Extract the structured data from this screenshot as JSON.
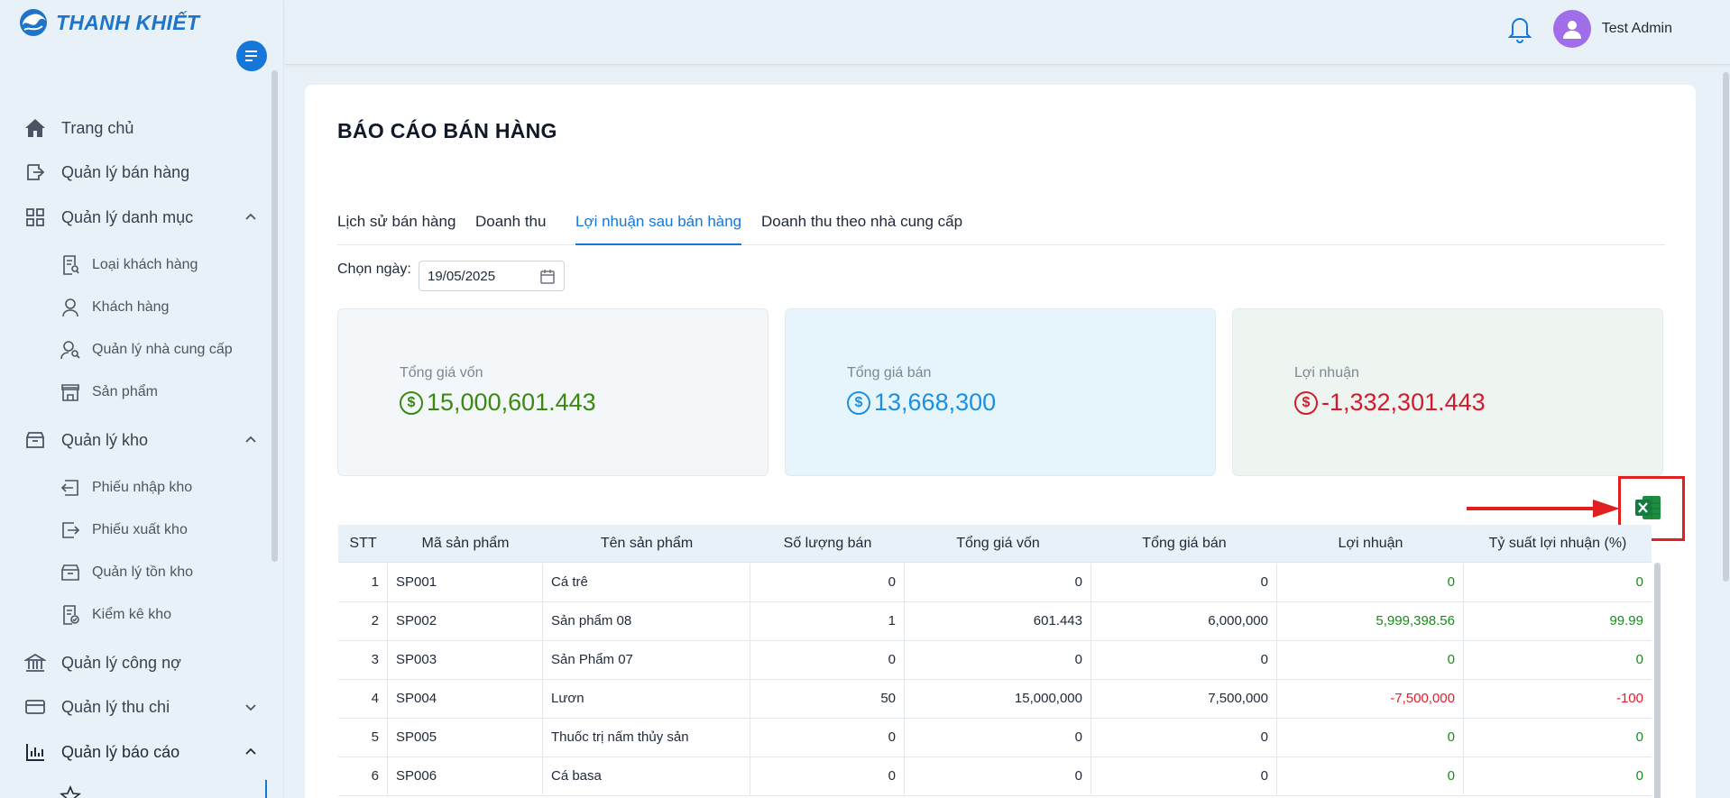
{
  "brand": {
    "name": "THANH KHIẾT"
  },
  "sidebar": {
    "items": [
      {
        "label": "Trang chủ",
        "icon": "home-icon"
      },
      {
        "label": "Quản lý bán hàng",
        "icon": "sales-icon"
      },
      {
        "label": "Quản lý danh mục",
        "icon": "grid-icon",
        "expanded": true
      },
      {
        "label": "Quản lý kho",
        "icon": "box-icon",
        "expanded": true
      },
      {
        "label": "Quản lý công nợ",
        "icon": "bank-icon"
      },
      {
        "label": "Quản lý thu chi",
        "icon": "card-icon",
        "expanded": false
      },
      {
        "label": "Quản lý báo cáo",
        "icon": "chart-icon",
        "expanded": true
      }
    ],
    "danh_muc": [
      {
        "label": "Loại khách hàng",
        "icon": "customer-type-icon"
      },
      {
        "label": "Khách hàng",
        "icon": "user-icon"
      },
      {
        "label": "Quản lý nhà cung cấp",
        "icon": "supplier-icon"
      },
      {
        "label": "Sản phẩm",
        "icon": "store-icon"
      }
    ],
    "kho": [
      {
        "label": "Phiếu nhập kho",
        "icon": "import-icon"
      },
      {
        "label": "Phiếu xuất kho",
        "icon": "export-icon"
      },
      {
        "label": "Quản lý tồn kho",
        "icon": "inventory-icon"
      },
      {
        "label": "Kiểm kê kho",
        "icon": "checklist-icon"
      }
    ]
  },
  "header": {
    "username": "Test Admin"
  },
  "page": {
    "title": "BÁO CÁO BÁN HÀNG",
    "tabs": [
      {
        "label": "Lịch sử bán hàng"
      },
      {
        "label": "Doanh thu"
      },
      {
        "label": "Lợi nhuận sau bán hàng",
        "active": true
      },
      {
        "label": "Doanh thu theo nhà cung cấp"
      }
    ],
    "date_label": "Chọn ngày:",
    "date_value": "19/05/2025",
    "stats": [
      {
        "label": "Tổng giá vốn",
        "value": "15,000,601.443",
        "color": "#3a8a12",
        "bg": "#f4f7fa",
        "symbol": "$"
      },
      {
        "label": "Tổng giá bán",
        "value": "13,668,300",
        "color": "#1d8fe0",
        "bg": "#e6f5fc",
        "symbol": "$"
      },
      {
        "label": "Lợi nhuận",
        "value": "-1,332,301.443",
        "color": "#d11c2d",
        "bg": "#eef5f1",
        "symbol": "$"
      }
    ]
  },
  "table": {
    "headers": [
      "STT",
      "Mã sản phẩm",
      "Tên sản phẩm",
      "Số lượng bán",
      "Tổng giá vốn",
      "Tổng giá bán",
      "Lợi nhuận",
      "Tỷ suất lợi nhuận (%)"
    ],
    "rows": [
      [
        "1",
        "SP001",
        "Cá trê",
        "0",
        "0",
        "0",
        "0",
        "0"
      ],
      [
        "2",
        "SP002",
        "Sản phẩm 08",
        "1",
        "601.443",
        "6,000,000",
        "5,999,398.56",
        "99.99"
      ],
      [
        "3",
        "SP003",
        "Sản Phẩm 07",
        "0",
        "0",
        "0",
        "0",
        "0"
      ],
      [
        "4",
        "SP004",
        "Lươn",
        "50",
        "15,000,000",
        "7,500,000",
        "-7,500,000",
        "-100"
      ],
      [
        "5",
        "SP005",
        "Thuốc trị nấm thủy sản",
        "0",
        "0",
        "0",
        "0",
        "0"
      ],
      [
        "6",
        "SP006",
        "Cá basa",
        "0",
        "0",
        "0",
        "0",
        "0"
      ]
    ]
  }
}
